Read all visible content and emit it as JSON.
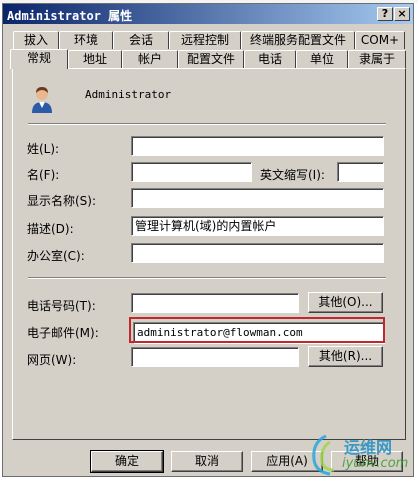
{
  "window": {
    "title": "Administrator 属性",
    "help_glyph": "?",
    "close_glyph": "×"
  },
  "tabs_row1": [
    "拔入",
    "环境",
    "会话",
    "远程控制",
    "终端服务配置文件",
    "COM+"
  ],
  "tabs_row2": [
    "常规",
    "地址",
    "帐户",
    "配置文件",
    "电话",
    "单位",
    "隶属于"
  ],
  "general": {
    "user_icon": "user-icon",
    "display_name": "Administrator",
    "labels": {
      "last_name": "姓(L):",
      "first_name": "名(F):",
      "initials": "英文缩写(I):",
      "display_name": "显示名称(S):",
      "description": "描述(D):",
      "office": "办公室(C):",
      "phone": "电话号码(T):",
      "email": "电子邮件(M):",
      "web": "网页(W):"
    },
    "values": {
      "last_name": "",
      "first_name": "",
      "initials": "",
      "display_name": "",
      "description": "管理计算机(域)的内置帐户",
      "office": "",
      "phone": "",
      "email": "administrator@flowman.com",
      "web": ""
    },
    "other_phone_label": "其他(O)...",
    "other_web_label": "其他(R)..."
  },
  "footer": {
    "ok": "确定",
    "cancel": "取消",
    "apply": "应用(A)",
    "help": "帮助"
  },
  "watermark": {
    "brand": "运维网",
    "url": "iyunv.com"
  },
  "colors": {
    "titlebar": "#0a246a",
    "face": "#d4d0c8",
    "highlight": "#c0282e"
  }
}
